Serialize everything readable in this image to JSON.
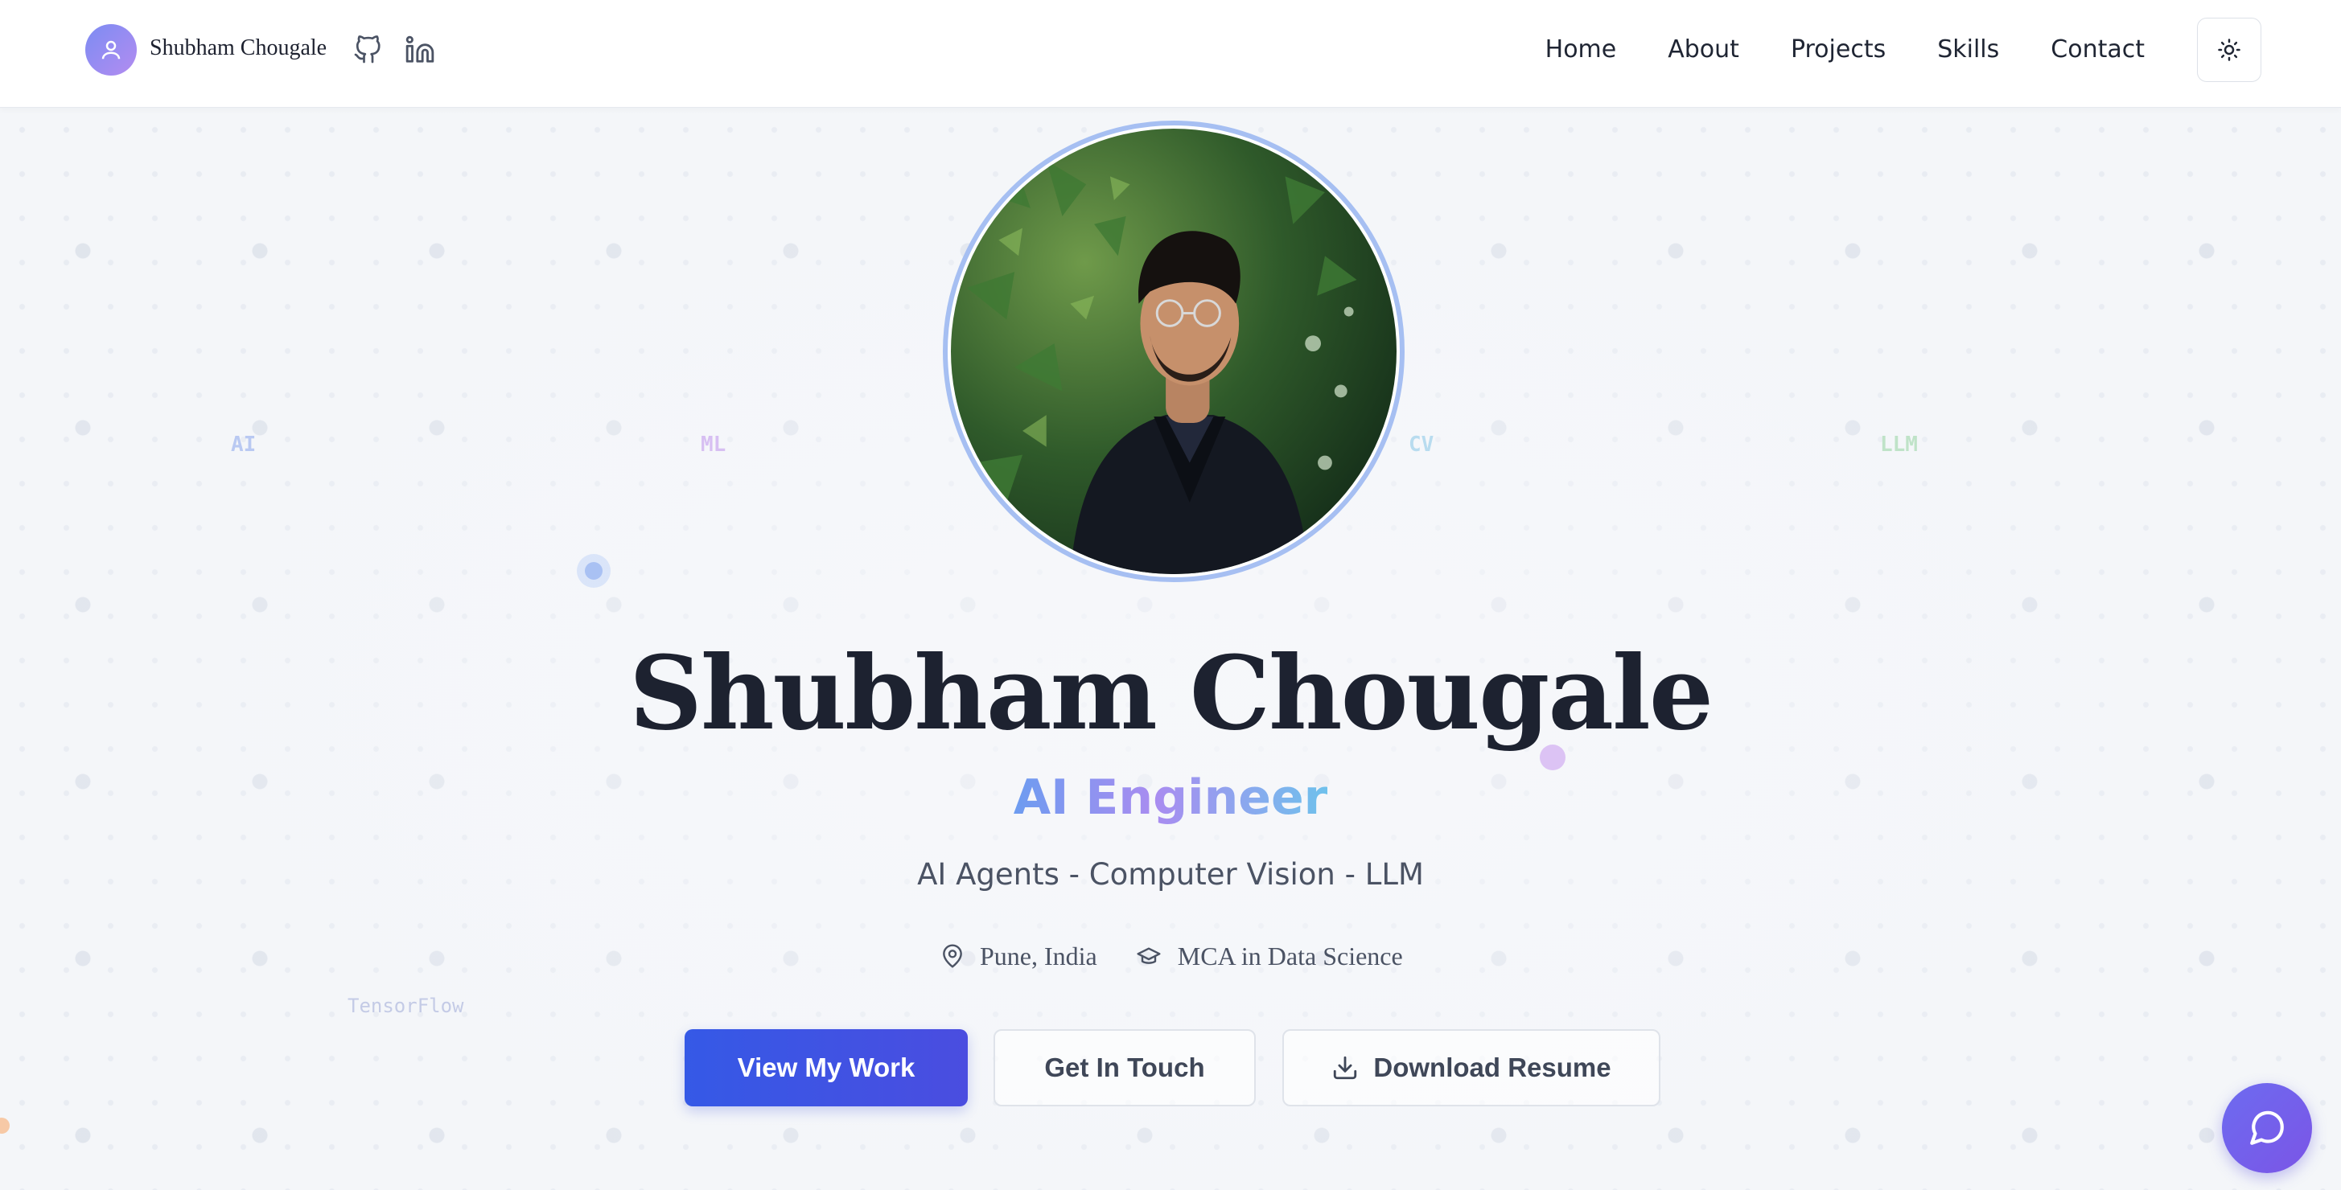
{
  "nav": {
    "brand_name": "Shubham Chougale",
    "links": [
      "Home",
      "About",
      "Projects",
      "Skills",
      "Contact"
    ],
    "icons": [
      "github-icon",
      "linkedin-icon",
      "sun-icon"
    ]
  },
  "floating_words": [
    "AI",
    "ML",
    "CV",
    "LLM",
    "TensorFlow"
  ],
  "hero": {
    "name": "Shubham Chougale",
    "role": "AI Engineer",
    "tagline": "AI Agents - Computer Vision - LLM",
    "location": "Pune, India",
    "education": "MCA in Data Science"
  },
  "buttons": {
    "view_work": "View My Work",
    "get_in_touch": "Get In Touch",
    "download_resume": "Download Resume"
  },
  "colors": {
    "primary": "#3559e6",
    "accent_purple": "#a98cf0",
    "accent_blue": "#6d9cf0",
    "text_dark": "#1d2230",
    "text_muted": "#4b5364"
  }
}
